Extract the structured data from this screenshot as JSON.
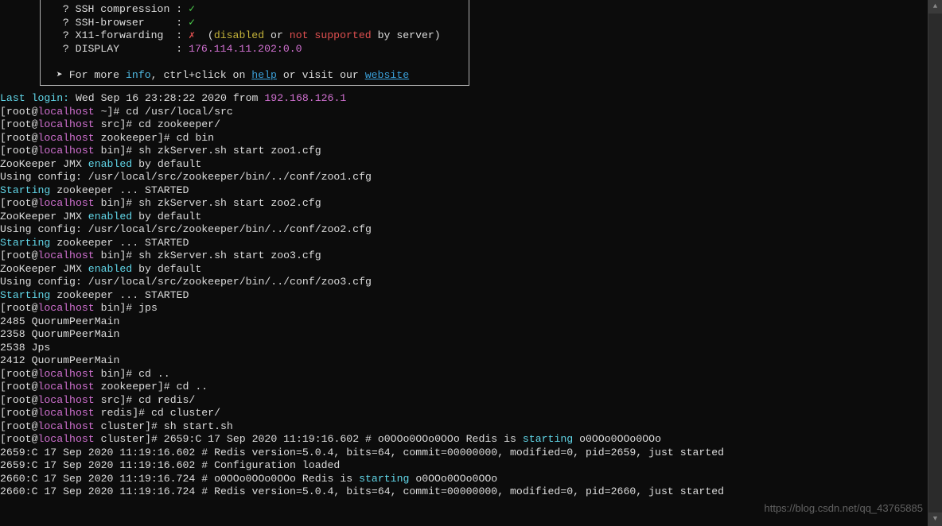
{
  "box": {
    "l1_a": "  ? SSH compression : ",
    "l1_b": "✓",
    "l2_a": "  ? SSH-browser     : ",
    "l2_b": "✓",
    "l3_a": "  ? X11-forwarding  : ",
    "l3_b": "✗",
    "l3_c": "  (",
    "l3_d": "disabled",
    "l3_e": " or ",
    "l3_f": "not supported",
    "l3_g": " by server)",
    "l4_a": "  ? DISPLAY         : ",
    "l4_b": "176.114.11.202:0.0",
    "bl": " ",
    "l5_a": " ➤ For more ",
    "l5_b": "info",
    "l5_c": ", ctrl+click on ",
    "l5_d": "help",
    "l5_e": " or visit our ",
    "l5_f": "website"
  },
  "login": {
    "a": "Last login:",
    "b": " Wed Sep 16 23:28:22 2020 from ",
    "c": "192.168.126.1"
  },
  "p1": {
    "host": "localhost",
    "path": " ~]# ",
    "cmd": "cd /usr/local/src"
  },
  "p2": {
    "host": "localhost",
    "path": " src]# ",
    "cmd": "cd zookeeper/"
  },
  "p3": {
    "host": "localhost",
    "path": " zookeeper]# ",
    "cmd": "cd bin"
  },
  "p4": {
    "host": "localhost",
    "path": " bin]# ",
    "cmd": "sh zkServer.sh start zoo1.cfg"
  },
  "zk1": {
    "a": "ZooKeeper JMX ",
    "b": "enabled",
    "c": " by default",
    "cfg": "Using config: /usr/local/src/zookeeper/bin/../conf/zoo1.cfg",
    "s1": "Starting",
    "s2": " zookeeper ... STARTED"
  },
  "p5": {
    "host": "localhost",
    "path": " bin]# ",
    "cmd": "sh zkServer.sh start zoo2.cfg"
  },
  "zk2": {
    "a": "ZooKeeper JMX ",
    "b": "enabled",
    "c": " by default",
    "cfg": "Using config: /usr/local/src/zookeeper/bin/../conf/zoo2.cfg",
    "s1": "Starting",
    "s2": " zookeeper ... STARTED"
  },
  "p6": {
    "host": "localhost",
    "path": " bin]# ",
    "cmd": "sh zkServer.sh start zoo3.cfg"
  },
  "zk3": {
    "a": "ZooKeeper JMX ",
    "b": "enabled",
    "c": " by default",
    "cfg": "Using config: /usr/local/src/zookeeper/bin/../conf/zoo3.cfg",
    "s1": "Starting",
    "s2": " zookeeper ... STARTED"
  },
  "p7": {
    "host": "localhost",
    "path": " bin]# ",
    "cmd": "jps"
  },
  "jps": {
    "l1": "2485 QuorumPeerMain",
    "l2": "2358 QuorumPeerMain",
    "l3": "2538 Jps",
    "l4": "2412 QuorumPeerMain"
  },
  "p8": {
    "host": "localhost",
    "path": " bin]# ",
    "cmd": "cd .."
  },
  "p9": {
    "host": "localhost",
    "path": " zookeeper]# ",
    "cmd": "cd .."
  },
  "p10": {
    "host": "localhost",
    "path": " src]# ",
    "cmd": "cd redis/"
  },
  "p11": {
    "host": "localhost",
    "path": " redis]# ",
    "cmd": "cd cluster/"
  },
  "p12": {
    "host": "localhost",
    "path": " cluster]# ",
    "cmd": "sh start.sh"
  },
  "p13": {
    "host": "localhost",
    "path": " cluster]# ",
    "a": "2659:C 17 Sep 2020 11:19:16.602 # o0OOo0OOo0OOo Redis is ",
    "b": "starting",
    "c": " o0OOo0OOo0OOo"
  },
  "redis": {
    "l1": "2659:C 17 Sep 2020 11:19:16.602 # Redis version=5.0.4, bits=64, commit=00000000, modified=0, pid=2659, just started",
    "l2": "2659:C 17 Sep 2020 11:19:16.602 # Configuration loaded",
    "l3a": "2660:C 17 Sep 2020 11:19:16.724 # o0OOo0OOo0OOo Redis is ",
    "l3b": "starting",
    "l3c": " o0OOo0OOo0OOo",
    "l4": "2660:C 17 Sep 2020 11:19:16.724 # Redis version=5.0.4, bits=64, commit=00000000, modified=0, pid=2660, just started"
  },
  "root": "[root@",
  "watermark": "https://blog.csdn.net/qq_43765885",
  "arrows": {
    "up": "▲",
    "down": "▼"
  }
}
